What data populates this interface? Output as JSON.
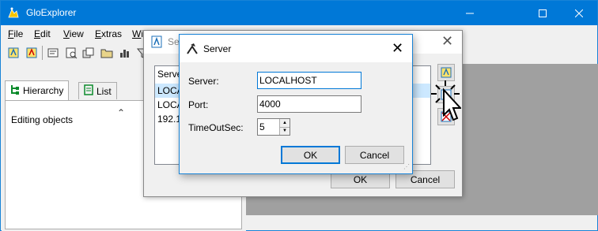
{
  "app": {
    "title": "GloExplorer",
    "icon": "gloexplorer-app-icon",
    "window_buttons": [
      "minimize",
      "maximize",
      "close"
    ]
  },
  "menu": {
    "items": [
      {
        "label": "File",
        "mnemonic": "F",
        "rest": "ile"
      },
      {
        "label": "Edit",
        "mnemonic": "E",
        "rest": "dit"
      },
      {
        "label": "View",
        "mnemonic": "V",
        "rest": "iew"
      },
      {
        "label": "Extras",
        "mnemonic": "E",
        "rest": "xtras"
      },
      {
        "label": "Wi",
        "mnemonic": "W",
        "rest": "i"
      }
    ]
  },
  "toolbar": {
    "icons": [
      "connect-icon",
      "disconnect-icon",
      "class-icon",
      "inspect-icon",
      "objects-icon",
      "folder-icon",
      "chart-icon",
      "filter-icon"
    ]
  },
  "left_pane": {
    "tabs": [
      {
        "label": "Hierarchy",
        "icon": "hierarchy-icon",
        "active": true
      },
      {
        "label": "List",
        "icon": "list-icon",
        "active": false
      }
    ],
    "tree_text": "Editing objects"
  },
  "server_list_dialog": {
    "title": "Se",
    "list_header": "Serve",
    "rows": [
      "LOCA",
      "LOCA",
      "192.1"
    ],
    "ok_label": "OK",
    "cancel_label": "Cancel"
  },
  "server_dialog": {
    "title": "Server",
    "server_label": "Server:",
    "server_value": "LOCALHOST",
    "port_label": "Port:",
    "port_value": "4000",
    "timeout_label": "TimeOutSec:",
    "timeout_value": "5",
    "ok_label": "OK",
    "cancel_label": "Cancel"
  },
  "colors": {
    "titlebar": "#0078d7",
    "accent": "#0078d7",
    "workspace": "#a0a0a0",
    "selection": "#cce8ff"
  }
}
